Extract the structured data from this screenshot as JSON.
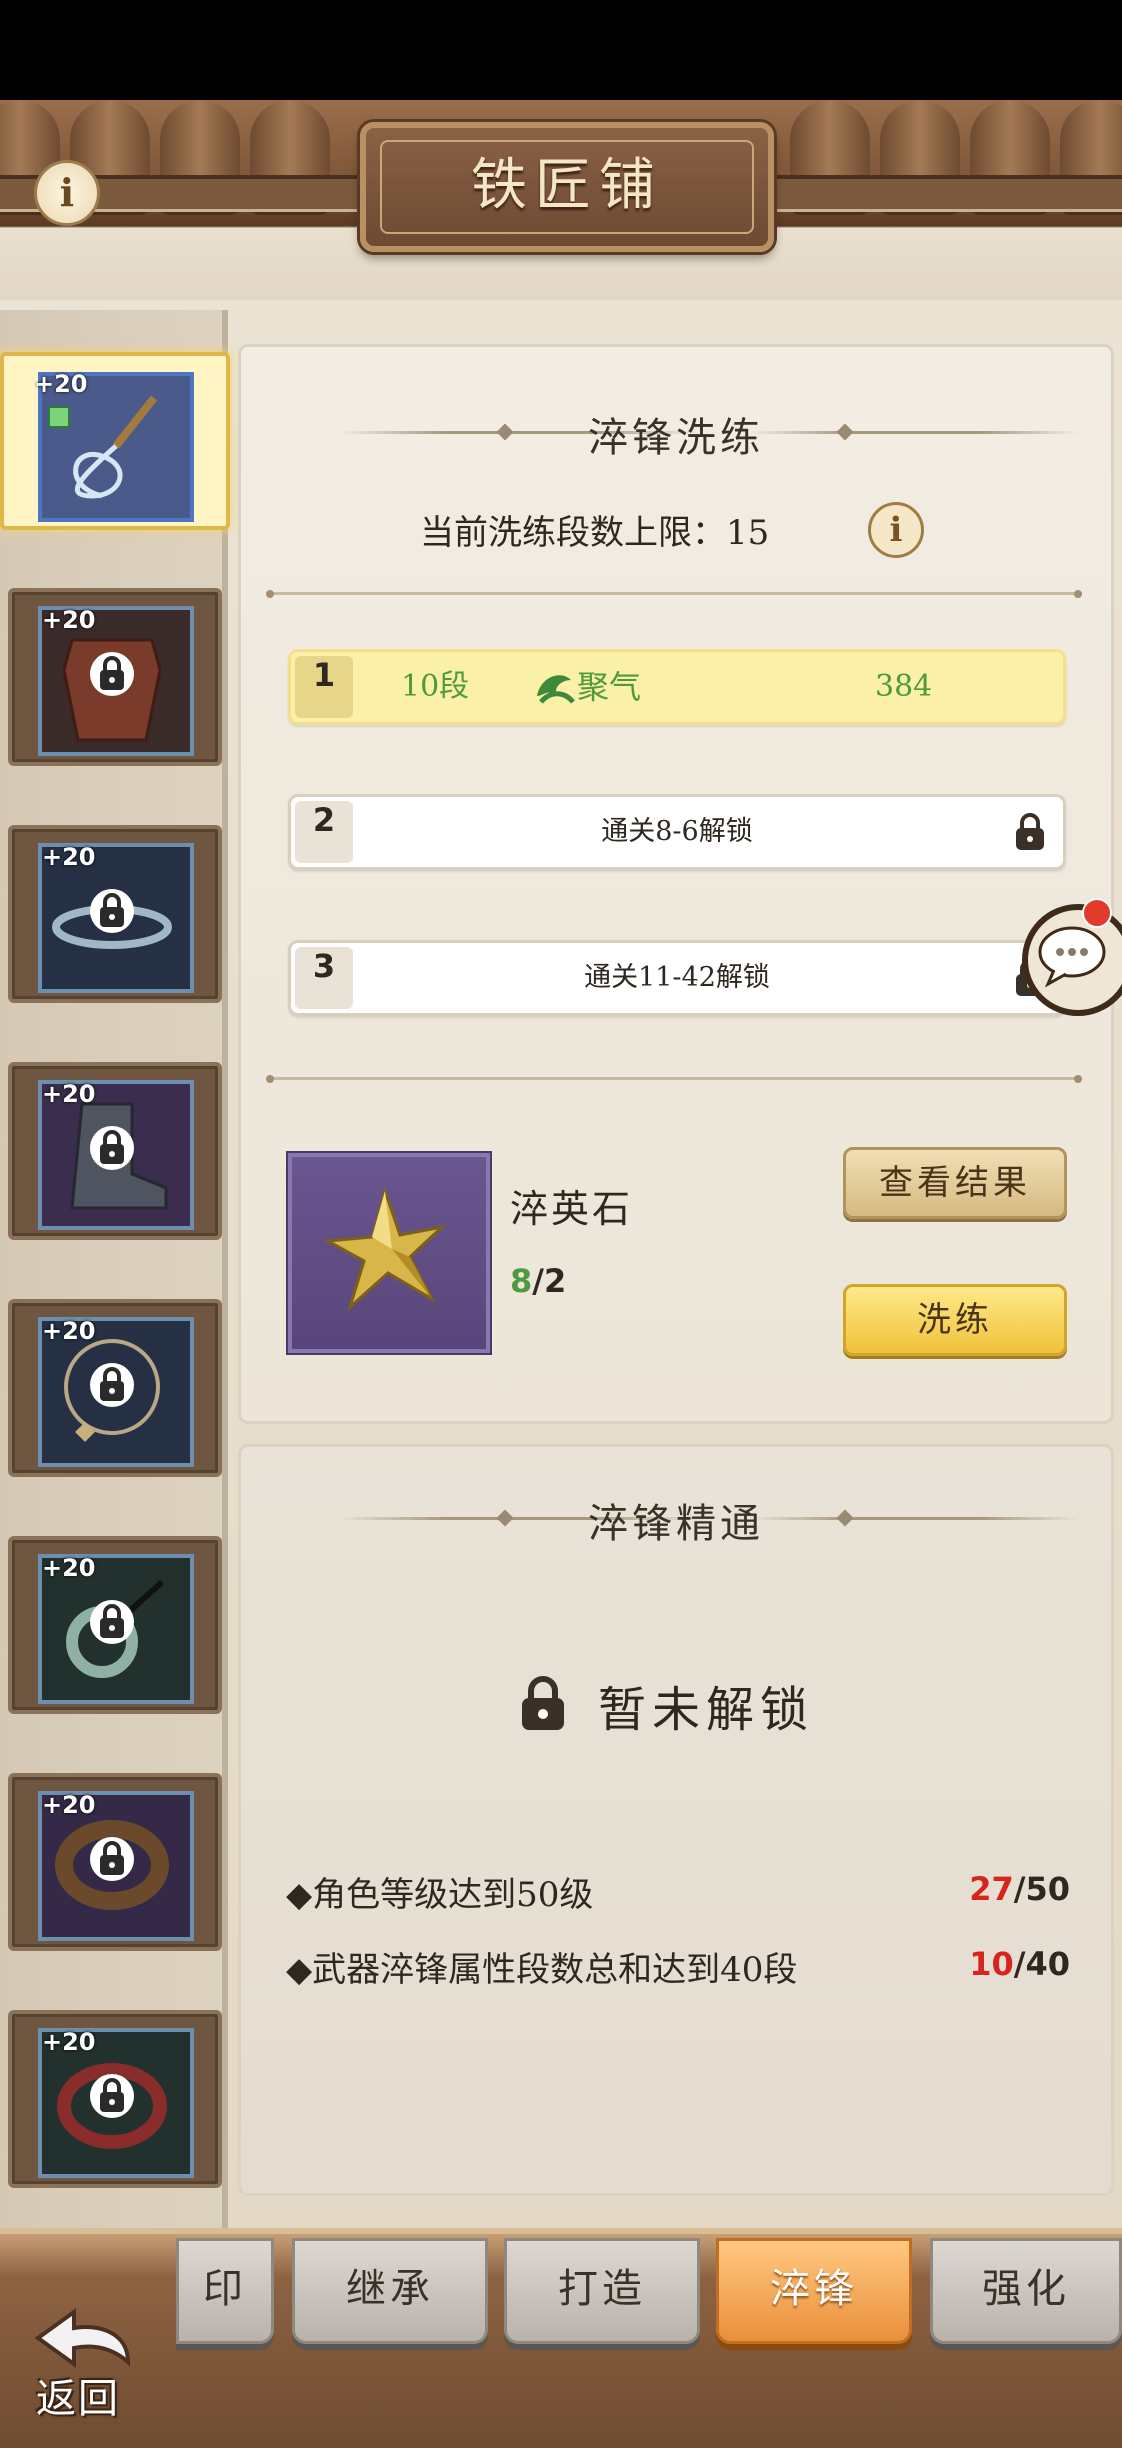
{
  "header": {
    "title": "铁匠铺",
    "info_icon": "info-icon"
  },
  "equipment": [
    {
      "level": "+20",
      "item": "whip",
      "selected": true
    },
    {
      "level": "+20",
      "item": "armor",
      "selected": false,
      "locked": true
    },
    {
      "level": "+20",
      "item": "belt",
      "selected": false,
      "locked": true
    },
    {
      "level": "+20",
      "item": "boots",
      "selected": false,
      "locked": true
    },
    {
      "level": "+20",
      "item": "necklace",
      "selected": false,
      "locked": true
    },
    {
      "level": "+20",
      "item": "jade-pendant",
      "selected": false,
      "locked": true
    },
    {
      "level": "+20",
      "item": "bracelet",
      "selected": false,
      "locked": true
    },
    {
      "level": "+20",
      "item": "ring",
      "selected": false,
      "locked": true
    }
  ],
  "refine_panel": {
    "title": "淬锋洗练",
    "limit_text": "当前洗练段数上限：15",
    "tiers": [
      {
        "num": "1",
        "level": "10段",
        "attr": "聚气",
        "value": "384",
        "active": true
      },
      {
        "num": "2",
        "label": "通关8-6解锁",
        "locked": true
      },
      {
        "num": "3",
        "label": "通关11-42解锁",
        "locked": true
      }
    ],
    "material": {
      "name": "淬英石",
      "have": "8",
      "need": "/2"
    },
    "view_button": "查看结果",
    "refine_button": "洗练"
  },
  "mastery_panel": {
    "title": "淬锋精通",
    "locked_text": "暂未解锁",
    "conditions": [
      {
        "text": "◆角色等级达到50级",
        "current": "27",
        "target": "/50"
      },
      {
        "text": "◆武器淬锋属性段数总和达到40段",
        "current": "10",
        "target": "/40"
      }
    ]
  },
  "tabs": [
    {
      "label": "印",
      "active": false
    },
    {
      "label": "继承",
      "active": false
    },
    {
      "label": "打造",
      "active": false
    },
    {
      "label": "淬锋",
      "active": true
    },
    {
      "label": "强化",
      "active": false
    }
  ],
  "back_label": "返回",
  "colors": {
    "accent_gold": "#f0c13a",
    "highlight_row": "#fbf0a8",
    "progress_red": "#d5251c",
    "have_green": "#4f9a3e"
  }
}
